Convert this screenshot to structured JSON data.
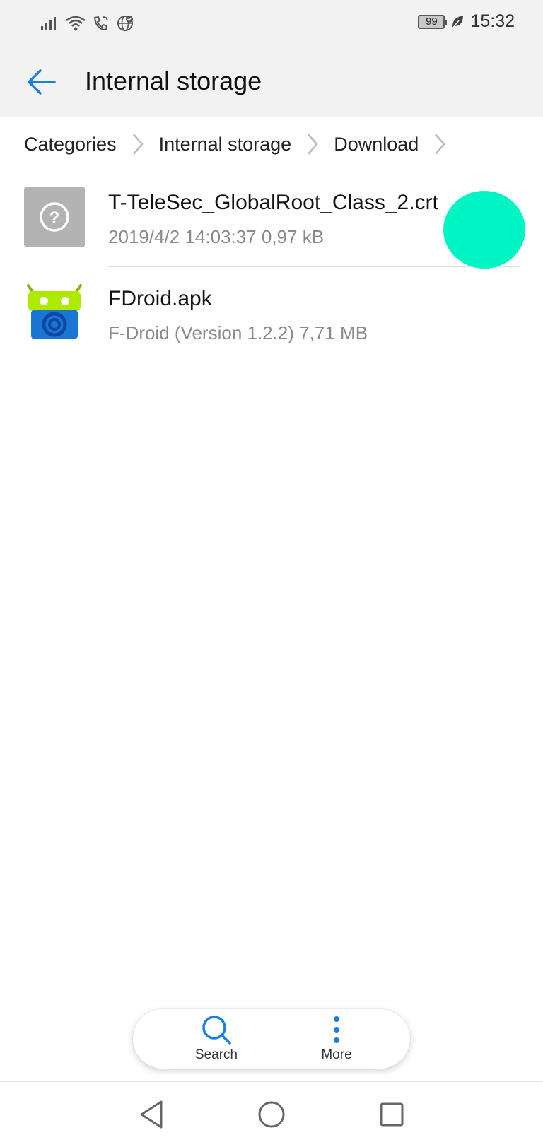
{
  "status_bar": {
    "battery": "99",
    "time": "15:32",
    "icons": [
      "signal-icon",
      "wifi-icon",
      "wifi-call-icon",
      "globe-icon",
      "leaf-icon"
    ]
  },
  "app_bar": {
    "title": "Internal storage",
    "back_icon": "arrow-left-icon"
  },
  "breadcrumb": {
    "items": [
      "Categories",
      "Internal storage",
      "Download"
    ]
  },
  "files": [
    {
      "name": "T-TeleSec_GlobalRoot_Class_2.crt",
      "meta": "2019/4/2 14:03:37 0,97 kB",
      "icon": "unknown-file-icon"
    },
    {
      "name": "FDroid.apk",
      "meta": "F-Droid (Version 1.2.2) 7,71 MB",
      "icon": "fdroid-app-icon"
    }
  ],
  "actions": {
    "search_label": "Search",
    "more_label": "More"
  },
  "colors": {
    "accent": "#1a7fe0",
    "touch_indicator": "#00f5c4",
    "bar_background": "#f2f2f2"
  }
}
